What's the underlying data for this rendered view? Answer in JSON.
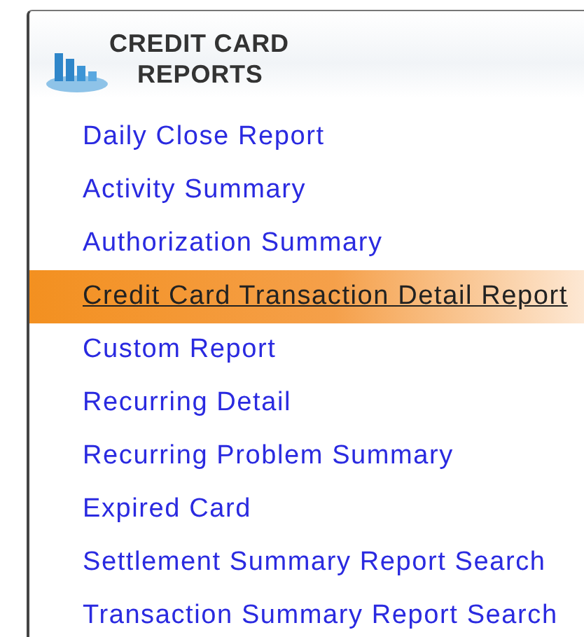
{
  "panel": {
    "title_line_1": "CREDIT CARD",
    "title_line_2": "REPORTS"
  },
  "items": [
    {
      "label": "Daily Close Report",
      "selected": false
    },
    {
      "label": "Activity Summary",
      "selected": false
    },
    {
      "label": "Authorization Summary",
      "selected": false
    },
    {
      "label": "Credit Card Transaction Detail Report",
      "selected": true
    },
    {
      "label": "Custom Report",
      "selected": false
    },
    {
      "label": "Recurring Detail",
      "selected": false
    },
    {
      "label": "Recurring Problem Summary",
      "selected": false
    },
    {
      "label": "Expired Card",
      "selected": false
    },
    {
      "label": "Settlement Summary Report Search",
      "selected": false
    },
    {
      "label": "Transaction Summary Report Search",
      "selected": false
    }
  ]
}
